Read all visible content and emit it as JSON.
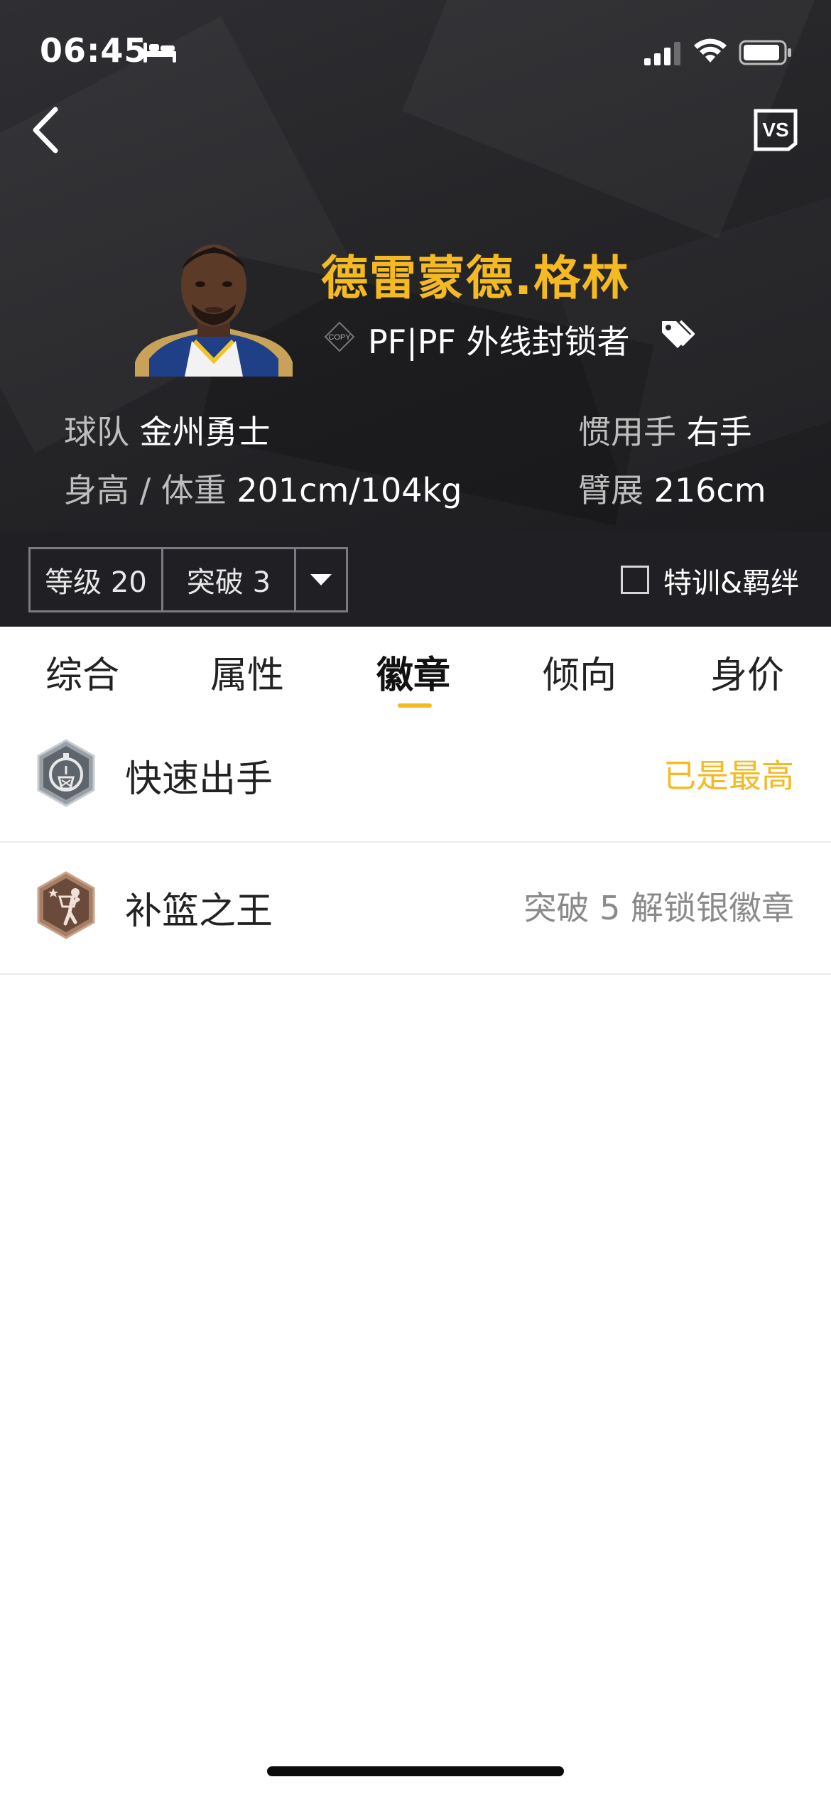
{
  "status_bar": {
    "time": "06:45",
    "icons": [
      "bed-icon",
      "signal-icon",
      "wifi-icon",
      "battery-icon"
    ]
  },
  "header": {
    "back_icon": "chevron-left-icon",
    "vs_label": "VS"
  },
  "player": {
    "name": "德雷蒙德.格林",
    "copy_label": "COPY",
    "position": "PF|PF 外线封锁者",
    "tag_icon": "tag-icon"
  },
  "info": {
    "team_label": "球队",
    "team_value": "金州勇士",
    "hand_label": "惯用手",
    "hand_value": "右手",
    "body_label": "身高 / 体重",
    "body_value": "201cm/104kg",
    "wingspan_label": "臂展",
    "wingspan_value": "216cm"
  },
  "level_bar": {
    "level": "等级 20",
    "breakthrough": "突破 3",
    "training_label": "特训&羁绊",
    "training_checked": false
  },
  "tabs": [
    {
      "label": "综合"
    },
    {
      "label": "属性"
    },
    {
      "label": "徽章",
      "active": true
    },
    {
      "label": "倾向"
    },
    {
      "label": "身价"
    }
  ],
  "badges": [
    {
      "name": "快速出手",
      "status": "已是最高",
      "icon": "stopwatch-hoop-badge-icon"
    },
    {
      "name": "补篮之王",
      "status": "突破 5 解锁银徽章",
      "icon": "putback-badge-icon"
    }
  ],
  "colors": {
    "accent": "#f5b922",
    "hero_bg": "#262629",
    "level_bar_bg": "#1f1f24"
  }
}
